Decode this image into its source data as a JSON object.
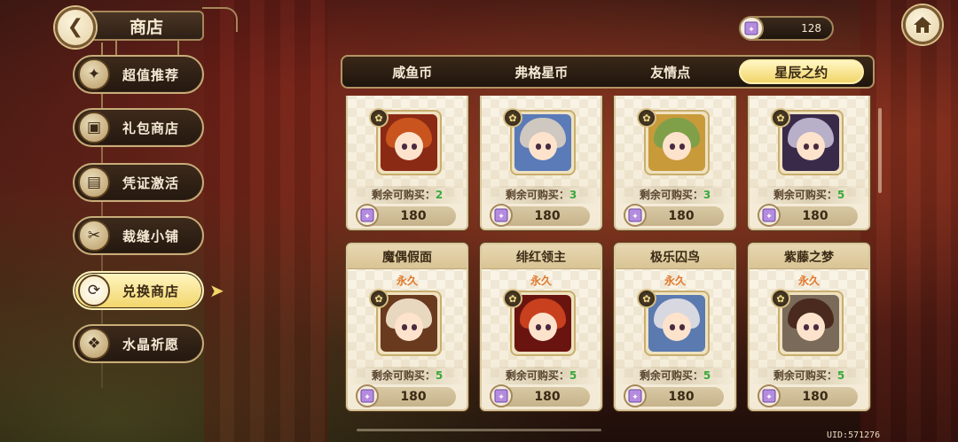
{
  "header": {
    "title": "商店",
    "back_icon": "back-arrow-icon"
  },
  "currency": {
    "icon": "star-crystal-icon",
    "value": "128"
  },
  "home": {
    "icon": "home-icon"
  },
  "sidebar": {
    "items": [
      {
        "label": "超值推荐",
        "icon": "sparkle-icon",
        "active": false
      },
      {
        "label": "礼包商店",
        "icon": "gift-icon",
        "active": false
      },
      {
        "label": "凭证激活",
        "icon": "voucher-icon",
        "active": false
      },
      {
        "label": "裁缝小铺",
        "icon": "tailor-icon",
        "active": false
      },
      {
        "label": "兑换商店",
        "icon": "exchange-icon",
        "active": true
      },
      {
        "label": "水晶祈愿",
        "icon": "crystal-icon",
        "active": false
      }
    ]
  },
  "tabs": [
    {
      "label": "咸鱼币",
      "active": false
    },
    {
      "label": "弗格星币",
      "active": false
    },
    {
      "label": "友情点",
      "active": false
    },
    {
      "label": "星辰之约",
      "active": true
    }
  ],
  "items": [
    {
      "name": "",
      "duration": "",
      "remain_label": "剩余可购买：",
      "remain": "2",
      "price": "180",
      "hair": "#c9541e",
      "bg": "#8b2a14"
    },
    {
      "name": "",
      "duration": "",
      "remain_label": "剩余可购买：",
      "remain": "3",
      "price": "180",
      "hair": "#cfc8c0",
      "bg": "#5a7ab8"
    },
    {
      "name": "",
      "duration": "",
      "remain_label": "剩余可购买：",
      "remain": "3",
      "price": "180",
      "hair": "#7fa048",
      "bg": "#c89a3a"
    },
    {
      "name": "",
      "duration": "",
      "remain_label": "剩余可购买：",
      "remain": "5",
      "price": "180",
      "hair": "#b8b0c8",
      "bg": "#3a2a4a"
    },
    {
      "name": "魔偶假面",
      "duration": "永久",
      "remain_label": "剩余可购买：",
      "remain": "5",
      "price": "180",
      "hair": "#e8d8c0",
      "bg": "#6a3a1e"
    },
    {
      "name": "绯红领主",
      "duration": "永久",
      "remain_label": "剩余可购买：",
      "remain": "5",
      "price": "180",
      "hair": "#c8401e",
      "bg": "#6a1410"
    },
    {
      "name": "极乐囚鸟",
      "duration": "永久",
      "remain_label": "剩余可购买：",
      "remain": "5",
      "price": "180",
      "hair": "#d8d8e0",
      "bg": "#5a7ab0"
    },
    {
      "name": "紫藤之梦",
      "duration": "永久",
      "remain_label": "剩余可购买：",
      "remain": "5",
      "price": "180",
      "hair": "#4a2a1e",
      "bg": "#7a6a5a"
    }
  ],
  "footer": {
    "uid": "UID:571276"
  },
  "colors": {
    "accent": "#f2d56a",
    "remain_count": "#3aa83a",
    "duration": "#e0782c",
    "panel": "#f3ead5"
  }
}
